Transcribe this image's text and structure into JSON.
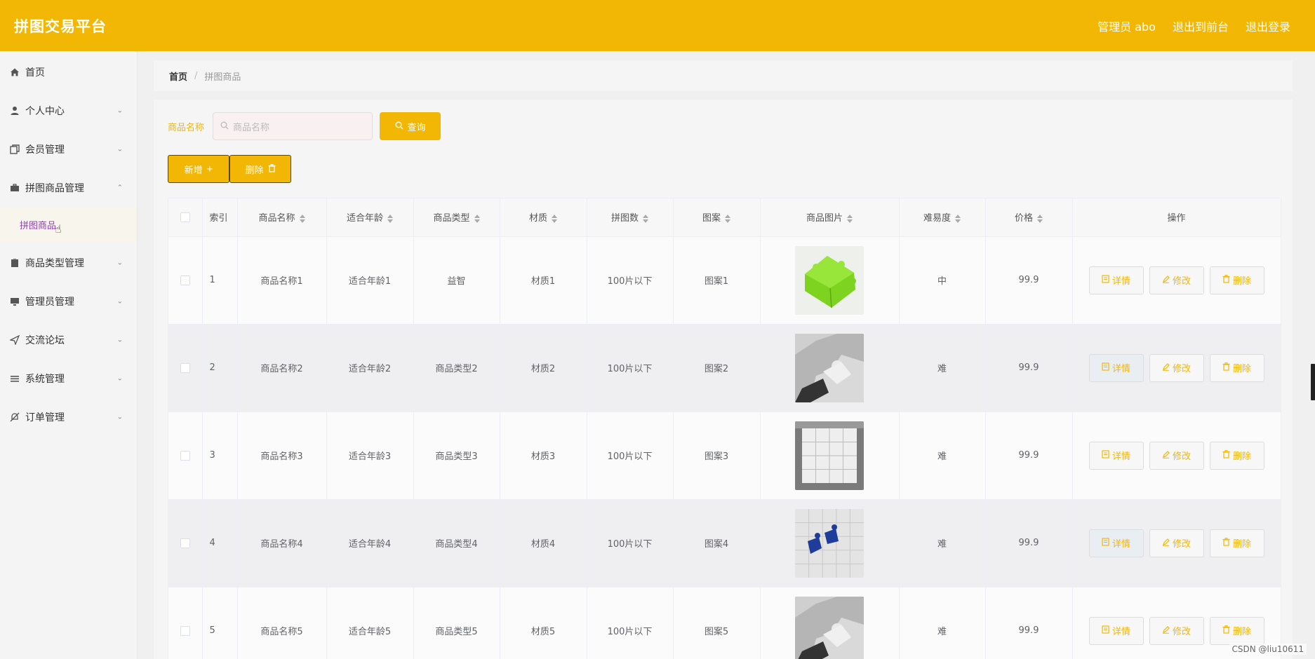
{
  "header": {
    "brand": "拼图交易平台",
    "admin": "管理员 abo",
    "to_front": "退出到前台",
    "logout": "退出登录"
  },
  "sidebar": {
    "items": [
      {
        "label": "首页",
        "icon": "home-icon",
        "chevron": false
      },
      {
        "label": "个人中心",
        "icon": "user-icon",
        "chevron": true
      },
      {
        "label": "会员管理",
        "icon": "copy-icon",
        "chevron": true
      },
      {
        "label": "拼图商品管理",
        "icon": "briefcase-icon",
        "chevron": true,
        "expanded": true
      },
      {
        "label": "商品类型管理",
        "icon": "clipboard-icon",
        "chevron": true
      },
      {
        "label": "管理员管理",
        "icon": "monitor-icon",
        "chevron": true
      },
      {
        "label": "交流论坛",
        "icon": "send-icon",
        "chevron": true
      },
      {
        "label": "系统管理",
        "icon": "list-icon",
        "chevron": true
      },
      {
        "label": "订单管理",
        "icon": "bell-off-icon",
        "chevron": true
      }
    ],
    "submenu_label": "拼图商品"
  },
  "breadcrumb": {
    "home": "首页",
    "sep": "/",
    "current": "拼图商品"
  },
  "search": {
    "label": "商品名称",
    "placeholder": "商品名称",
    "query_label": "查询"
  },
  "actions": {
    "add_label": "新增",
    "delete_label": "删除"
  },
  "table": {
    "headers": [
      "索引",
      "商品名称",
      "适合年龄",
      "商品类型",
      "材质",
      "拼图数",
      "图案",
      "商品图片",
      "难易度",
      "价格",
      "操作"
    ],
    "op_labels": {
      "detail": "详情",
      "edit": "修改",
      "delete": "删除"
    },
    "rows": [
      {
        "index": "1",
        "name": "商品名称1",
        "age": "适合年龄1",
        "type": "益智",
        "material": "材质1",
        "count": "100片以下",
        "pattern": "图案1",
        "image": "green-puzzle",
        "difficulty": "中",
        "price": "99.9"
      },
      {
        "index": "2",
        "name": "商品名称2",
        "age": "适合年龄2",
        "type": "商品类型2",
        "material": "材质2",
        "count": "100片以下",
        "pattern": "图案2",
        "image": "grey-puzzle-piece",
        "difficulty": "难",
        "price": "99.9"
      },
      {
        "index": "3",
        "name": "商品名称3",
        "age": "适合年龄3",
        "type": "商品类型3",
        "material": "材质3",
        "count": "100片以下",
        "pattern": "图案3",
        "image": "white-puzzle-grid",
        "difficulty": "难",
        "price": "99.9"
      },
      {
        "index": "4",
        "name": "商品名称4",
        "age": "适合年龄4",
        "type": "商品类型4",
        "material": "材质4",
        "count": "100片以下",
        "pattern": "图案4",
        "image": "blue-pieces",
        "difficulty": "难",
        "price": "99.9"
      },
      {
        "index": "5",
        "name": "商品名称5",
        "age": "适合年龄5",
        "type": "商品类型5",
        "material": "材质5",
        "count": "100片以下",
        "pattern": "图案5",
        "image": "grey-puzzle-piece",
        "difficulty": "难",
        "price": "99.9"
      }
    ]
  },
  "watermark": "CSDN @liu10611",
  "colors": {
    "accent": "#f2b705",
    "submenu_text": "#8e44ad"
  }
}
